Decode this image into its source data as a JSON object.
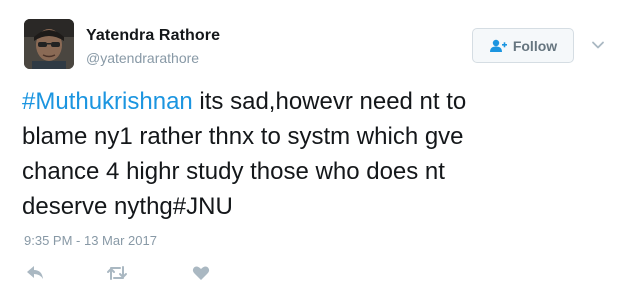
{
  "user": {
    "name": "Yatendra Rathore",
    "handle": "@yatendrarathore"
  },
  "follow_button": {
    "label": "Follow",
    "icon": "add-user-icon"
  },
  "menu": {
    "icon": "chevron-down-icon"
  },
  "tweet": {
    "hashtag_1": "#Muthukrishnan",
    "line_1": " its sad,howevr need nt to",
    "line_2": "blame ny1 rather thnx to systm which gve",
    "line_3": "chance 4  highr study those who does nt",
    "line_4_text": "deserve nythg",
    "hashtag_2": "#JNU"
  },
  "timestamp": "9:35 PM - 13 Mar 2017",
  "actions": [
    {
      "name": "reply",
      "icon": "reply-icon"
    },
    {
      "name": "retweet",
      "icon": "retweet-icon"
    },
    {
      "name": "like",
      "icon": "heart-icon"
    }
  ],
  "colors": {
    "link": "#1b95e0",
    "meta": "#8899a6",
    "icon": "#aab8c2",
    "text": "#14171a"
  }
}
